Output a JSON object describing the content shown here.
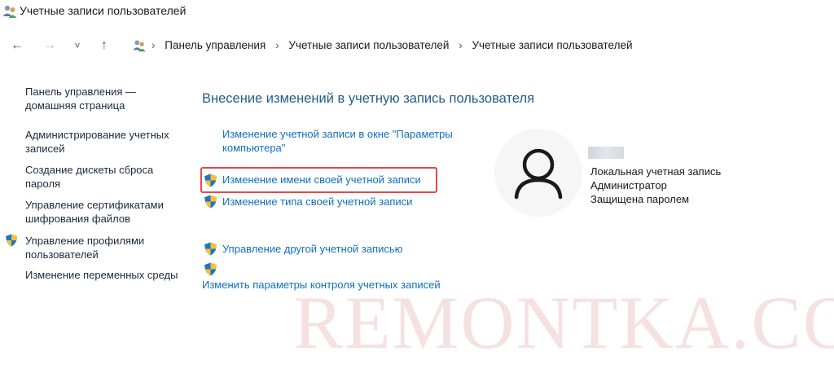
{
  "window": {
    "title": "Учетные записи пользователей",
    "icon": "users-icon"
  },
  "navbar": {
    "back_icon": "←",
    "forward_icon": "→",
    "recent_icon": "˅",
    "up_icon": "↑",
    "separator": "›",
    "breadcrumbs": [
      "Панель управления",
      "Учетные записи пользователей",
      "Учетные записи пользователей"
    ]
  },
  "sidebar": {
    "items": [
      {
        "label": "Панель управления — домашняя страница",
        "shield": false
      },
      {
        "label": "Администрирование учетных записей",
        "shield": false
      },
      {
        "label": "Создание дискеты сброса пароля",
        "shield": false
      },
      {
        "label": "Управление сертификатами шифрования файлов",
        "shield": false
      },
      {
        "label": "Управление профилями пользователей",
        "shield": true
      },
      {
        "label": "Изменение переменных среды",
        "shield": false
      }
    ]
  },
  "main": {
    "title": "Внесение изменений в учетную запись пользователя",
    "tasks": [
      {
        "line1": "Изменение учетной записи в окне \"Параметры",
        "line2": "компьютера\"",
        "shield": false
      },
      {
        "label": "Изменение имени своей учетной записи",
        "shield": true,
        "highlighted": true
      },
      {
        "label": "Изменение типа своей учетной записи",
        "shield": true
      },
      {
        "label": "Управление другой учетной записью",
        "shield": true
      },
      {
        "label": "Изменить параметры контроля учетных записей",
        "shield": true
      }
    ]
  },
  "account": {
    "avatar_icon": "user-avatar-icon",
    "lines": [
      "Локальная учетная запись",
      "Администратор",
      "Защищена паролем"
    ]
  },
  "watermark": {
    "text": "REMONTKA.COM"
  },
  "colors": {
    "link": "#0d6fbf",
    "heading": "#1f5d8a",
    "highlight_border": "#e34848"
  }
}
